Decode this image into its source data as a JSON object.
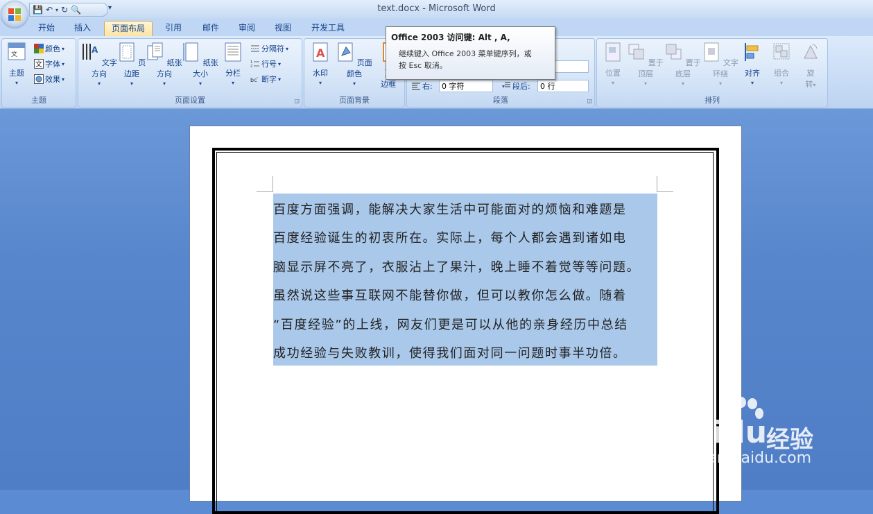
{
  "window": {
    "title": "text.docx - Microsoft Word"
  },
  "tabs": [
    {
      "label": "开始"
    },
    {
      "label": "插入"
    },
    {
      "label": "页面布局"
    },
    {
      "label": "引用"
    },
    {
      "label": "邮件"
    },
    {
      "label": "审阅"
    },
    {
      "label": "视图"
    },
    {
      "label": "开发工具"
    }
  ],
  "ribbon": {
    "themes": {
      "label": "主题",
      "theme": "主题",
      "colors": "颜色",
      "fonts": "字体",
      "effects": "效果"
    },
    "page_setup": {
      "label": "页面设置",
      "text_direction": "文字方向",
      "margins": "页边距",
      "orientation": "纸张方向",
      "size": "纸张大小",
      "columns": "分栏",
      "breaks": "分隔符",
      "line_numbers": "行号",
      "hyphenation": "断字"
    },
    "page_background": {
      "label": "页面背景",
      "watermark": "水印",
      "page_color": "页面颜色",
      "page_borders_a": "页",
      "page_borders_b": "边框"
    },
    "paragraph": {
      "label": "段落",
      "right_label": "右:",
      "right_value": "0 字符",
      "after_label": "段后:",
      "after_value": "0 行"
    },
    "arrange": {
      "label": "排列",
      "position": "位置",
      "bring_front": "置于顶层",
      "send_back": "置于底层",
      "text_wrap": "文字环绕",
      "align": "对齐",
      "group": "组合",
      "rotate_a": "旋",
      "rotate_b": "转"
    }
  },
  "tooltip": {
    "title": "Office 2003 访问键: Alt , A,",
    "line1": "继续键入 Office 2003 菜单键序列，或",
    "line2": "按 Esc 取消。"
  },
  "document": {
    "lines": [
      "百度方面强调，能解决大家生活中可能面对的烦恼和难题是",
      "百度经验诞生的初衷所在。实际上，每个人都会遇到诸如电",
      "脑显示屏不亮了，衣服沾上了果汁，晚上睡不着觉等等问题。",
      "虽然说这些事互联网不能替你做，但可以教你怎么做。随着",
      "“百度经验”的上线，网友们更是可以从他的亲身经历中总结",
      "成功经验与失败教训，使得我们面对同一问题时事半功倍。"
    ]
  },
  "watermark": {
    "brand": "Baidu",
    "suffix": "经验",
    "url": "jingyan.baidu.com"
  }
}
